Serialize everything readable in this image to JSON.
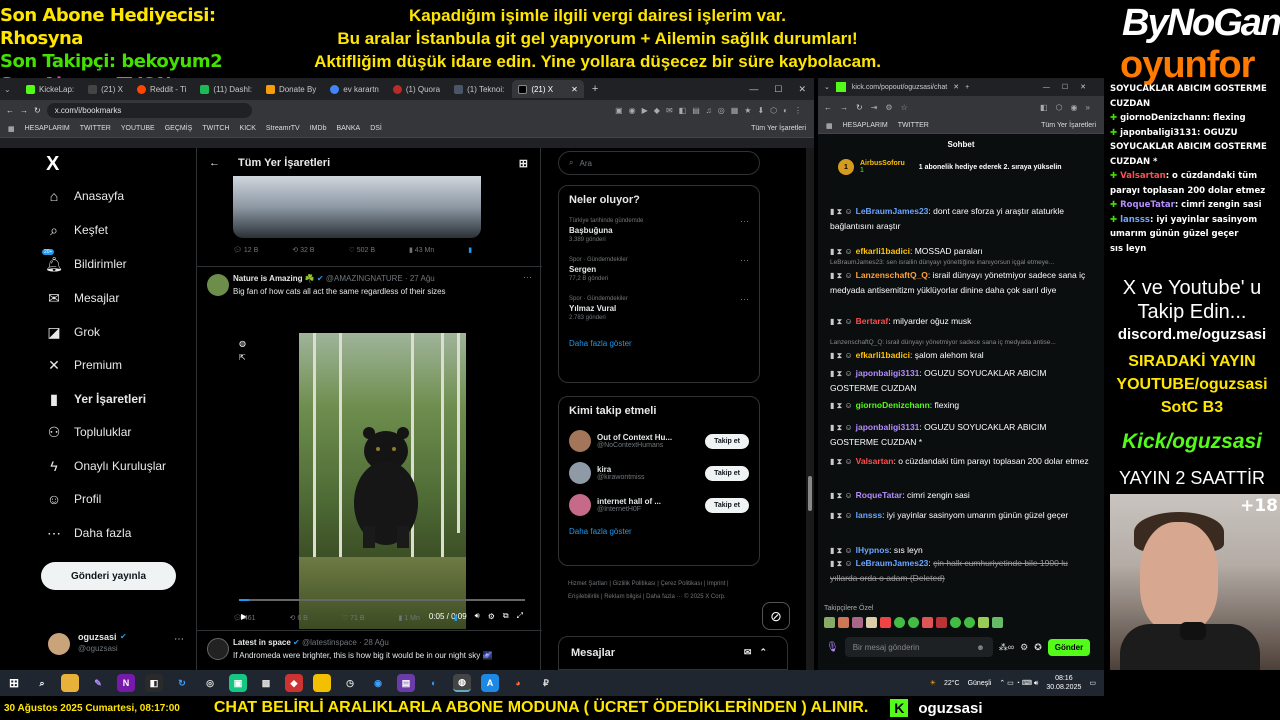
{
  "overlay": {
    "last_gift": "Son Abone Hediyecisi: Rhosyna",
    "last_follower": "Son Takipçi: bekoyum2",
    "last_sub": "Son Abone: TVQN",
    "announcement": [
      "Kapadığım işimle ilgili vergi dairesi işlerim var.",
      "Bu aralar İstanbula git gel yapıyorum + Ailemin sağlık durumları!",
      "Aktifliğim düşük idare edin. Yine yollara düşecez bir süre kaybolacam."
    ],
    "brand_top": "ByNoGame",
    "brand_bottom": "oyunfor"
  },
  "browser1": {
    "tabs": [
      "KickeLap:",
      "(21) X",
      "Reddit - Ti",
      "(11) Dashl:",
      "Donate By",
      "ev karartn",
      "(1) Quora",
      "(1) Teknoi:",
      "(21) X"
    ],
    "tab_colors": [
      "#53fc18",
      "#000000",
      "#ff4500",
      "#1db954",
      "#f59e0b",
      "#4285f4",
      "#b92b27",
      "#4a5568",
      "#000000"
    ],
    "url": "x.com/i/bookmarks",
    "bookmarks": [
      "HESAPLARIM",
      "TWITTER",
      "YOUTUBE",
      "GEÇMİŞ",
      "TWITCH",
      "KICK",
      "StreamrTV",
      "IMDb",
      "BANKA",
      "DSİ"
    ],
    "all_bookmarks": "Tüm Yer İşaretleri"
  },
  "x": {
    "logo": "X",
    "nav": [
      "Anasayfa",
      "Keşfet",
      "Bildirimler",
      "Mesajlar",
      "Grok",
      "Premium",
      "Yer İşaretleri",
      "Topluluklar",
      "Onaylı Kuruluşlar",
      "Profil",
      "Daha fazla"
    ],
    "notif_badge": "20+",
    "post_button": "Gönderi yayınla",
    "account_name": "oguzsasi",
    "account_handle": "@oguzsasi",
    "header": "Tüm Yer İşaretleri",
    "post1_stats": {
      "replies": "12 B",
      "reposts": "32 B",
      "likes": "502 B",
      "views": "43 Mn"
    },
    "post2": {
      "name": "Nature is Amazing ☘️",
      "handle": "@AMAZINGNATURE · 27 Ağu",
      "text": "Big fan of how cats all act the same regardless of their sizes",
      "time": "0:05 / 0:09",
      "stats": {
        "replies": "461",
        "reposts": "6 B",
        "likes": "71 B",
        "views": "1 Mn"
      }
    },
    "post3": {
      "name": "Latest in space",
      "handle": "@latestinspace · 28 Ağu",
      "text": "If Andromeda were brighter, this is how big it would be in our night sky 🌌"
    },
    "search_placeholder": "Ara",
    "trends_title": "Neler oluyor?",
    "trends": [
      {
        "context": "Türkiye tarihinde gündemde",
        "name": "Başbuğuna",
        "count": "3.389 gönderi"
      },
      {
        "context": "Spor · Gündemdekiler",
        "name": "Sergen",
        "count": "77,2 B gönderi"
      },
      {
        "context": "Spor · Gündemdekiler",
        "name": "Yılmaz Vural",
        "count": "2.783 gönderi"
      }
    ],
    "show_more": "Daha fazla göster",
    "wtf_title": "Kimi takip etmeli",
    "wtf": [
      {
        "name": "Out of Context Hu...",
        "handle": "@NoContextHumans",
        "color": "#a3765a"
      },
      {
        "name": "kira",
        "handle": "@kirawontmiss",
        "color": "#8e9aa6"
      },
      {
        "name": "internet hall of ...",
        "handle": "@InternetH0F",
        "color": "#c56b89"
      }
    ],
    "follow_label": "Takip et",
    "footer": "Hizmet Şartları | Gizlilik Politikası | Çerez Politikası | Imprint | Erişilebilirlik | Reklam bilgisi | Daha fazla ··· © 2025 X Corp.",
    "messages": "Mesajlar"
  },
  "browser2": {
    "url": "kick.com/popout/oguzsasi/chat",
    "bookmarks": [
      "HESAPLARIM",
      "TWITTER",
      "Tüm Yer İşaretleri"
    ],
    "chat_title": "Sohbet",
    "pinned_user": "AirbusSoforu",
    "pinned_count": "1",
    "pinned_text": "1 abonelik hediye ederek 2. sıraya yükselin",
    "messages": [
      {
        "user": "LeBraumJames23",
        "text": "dont care sforza yi araştır ataturkle bağlantısını araştır",
        "color": "#6ca6ff"
      },
      {
        "user": "efkarli1badici",
        "text": "MOSSAD paraları",
        "color": "#ffc107"
      },
      {
        "user": "",
        "text": "LeBraumJames23: sen israilin dünyayı yönettiğine inanıyorsun içgal etmeye...",
        "color": "#888"
      },
      {
        "user": "LanzenschaftQ_Q",
        "text": "israil dünyayı yönetmiyor sadece sana iç medyada antisemitizm yüklüyorlar dinine daha çok sarıl diye",
        "color": "#ffa23c"
      },
      {
        "user": "Bertaraf",
        "text": "milyarder oğuz musk",
        "color": "#ff4d4d"
      },
      {
        "user": "",
        "text": "LanzenschaftQ_Q: israil dünyayı yönetmiyor sadece sana iç medyada antise...",
        "color": "#888"
      },
      {
        "user": "efkarli1badici",
        "text": "şalom alehom kral",
        "color": "#ffc107"
      },
      {
        "user": "japonbaligi3131",
        "text": "OGUZU SOYUCAKLAR ABICIM GOSTERME CUZDAN",
        "color": "#b48cff"
      },
      {
        "user": "giornoDenizchann",
        "text": "flexing",
        "color": "#53fc18"
      },
      {
        "user": "japonbaligi3131",
        "text": "OGUZU SOYUCAKLAR ABICIM GOSTERME CUZDAN *",
        "color": "#b48cff"
      },
      {
        "user": "Valsartan",
        "text": "o cüzdandaki tüm parayı toplasan 200 dolar etmez",
        "color": "#ff4d4d"
      },
      {
        "user": "RoqueTatar",
        "text": "cimri zengin sasi",
        "color": "#b48cff"
      },
      {
        "user": "lansss",
        "text": "iyi yayinlar sasinyom umarım günün güzel geçer",
        "color": "#6ca6ff"
      },
      {
        "user": "lHypnos",
        "text": "sıs leyn",
        "color": "#6ca6ff"
      },
      {
        "user": "LeBraumJames23",
        "text": "çin halk cumhuriyetinde bile 1900 lu yıllarda orda o adam (Deleted)",
        "color": "#6ca6ff"
      }
    ],
    "favorites_label": "Takipçilere Özel",
    "input_placeholder": "Bir mesaj gönderin",
    "send_label": "Gönder"
  },
  "right_overlay": {
    "lines": [
      {
        "user": "",
        "text": "SOYUCAKLAR ABICIM GOSTERME CUZDAN"
      },
      {
        "user": "giornoDenizchann",
        "text": ": flexing"
      },
      {
        "user": "japonbaligi3131",
        "text": ": OGUZU SOYUCAKLAR ABICIM GOSTERME CUZDAN *"
      },
      {
        "user": "Valsartan",
        "text": ": o cüzdandaki tüm parayı toplasan 200 dolar etmez"
      },
      {
        "user": "RoqueTatar",
        "text": ": cimri zengin sasi"
      },
      {
        "user": "lansss",
        "text": ": iyi yayinlar sasinyom umarım günün güzel geçer"
      },
      {
        "user": "",
        "text": "sıs leyn"
      }
    ],
    "follow1": "X ve Youtube' u",
    "follow2": "Takip Edin...",
    "discord": "discord.me/oguzsasi",
    "next1": "SIRADAKİ YAYIN",
    "next2": "YOUTUBE/oguzsasi",
    "next3": "SotC B3",
    "kick": "Kick/oguzsasi",
    "uptime": "YAYIN 2 SAATTİR",
    "age": "+18"
  },
  "taskbar": {
    "weather": "22°C",
    "weather_desc": "Güneşli",
    "time": "08:16",
    "date": "30.08.2025"
  },
  "ticker": {
    "date": "30 Ağustos 2025 Cumartesi, 08:17:00",
    "message": "CHAT BELİRLİ ARALIKLARLA ABONE MODUNA ( ÜCRET ÖDEDİKLERİNDEN ) ALINIR.",
    "channel": "oguzsasi"
  }
}
